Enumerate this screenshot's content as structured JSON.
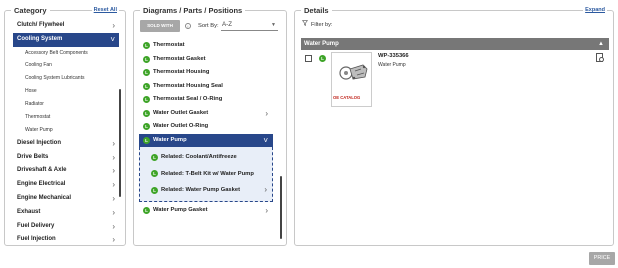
{
  "category": {
    "title": "Category",
    "reset_label": "Reset All",
    "items": [
      {
        "label": "Clutch/ Flywheel"
      },
      {
        "label": "Cooling System",
        "active": true,
        "children": [
          "Accessory Belt Components",
          "Cooling Fan",
          "Cooling System Lubricants",
          "Hose",
          "Radiator",
          "Thermostat",
          "Water Pump"
        ]
      },
      {
        "label": "Diesel Injection"
      },
      {
        "label": "Drive Belts"
      },
      {
        "label": "Driveshaft & Axle"
      },
      {
        "label": "Engine Electrical"
      },
      {
        "label": "Engine Mechanical"
      },
      {
        "label": "Exhaust"
      },
      {
        "label": "Fuel Delivery"
      },
      {
        "label": "Fuel Injection"
      }
    ]
  },
  "diagrams": {
    "title": "Diagrams / Parts / Positions",
    "sold_with_label": "SOLD WITH",
    "info_glyph": "i",
    "sort_by_label": "Sort By:",
    "sort_value": "A-Z",
    "icon_letter": "L",
    "items": [
      {
        "label": "Thermostat"
      },
      {
        "label": "Thermostat Gasket"
      },
      {
        "label": "Thermostat Housing"
      },
      {
        "label": "Thermostat Housing Seal"
      },
      {
        "label": "Thermostat Seal / O-Ring"
      },
      {
        "label": "Water Outlet Gasket",
        "chevron": true
      },
      {
        "label": "Water Outlet O-Ring"
      },
      {
        "label": "Water Pump",
        "active": true,
        "chevron": true
      }
    ],
    "related": [
      {
        "label": "Related: Coolant/Antifreeze"
      },
      {
        "label": "Related: T-Belt Kit w/ Water Pump"
      },
      {
        "label": "Related: Water Pump Gasket",
        "chevron": true
      }
    ],
    "after": [
      {
        "label": "Water Pump Gasket",
        "chevron": true
      }
    ]
  },
  "details": {
    "title": "Details",
    "expand_label": "Expand",
    "filter_label": "Filter by:",
    "section_header": "Water Pump",
    "part": {
      "number": "WP-335366",
      "name": "Water Pump",
      "brand": "OE CATALOG"
    }
  },
  "price_label": "PRICE",
  "colors": {
    "accent": "#28478a",
    "brand_green": "#3ea428",
    "header_gray": "#777777"
  }
}
